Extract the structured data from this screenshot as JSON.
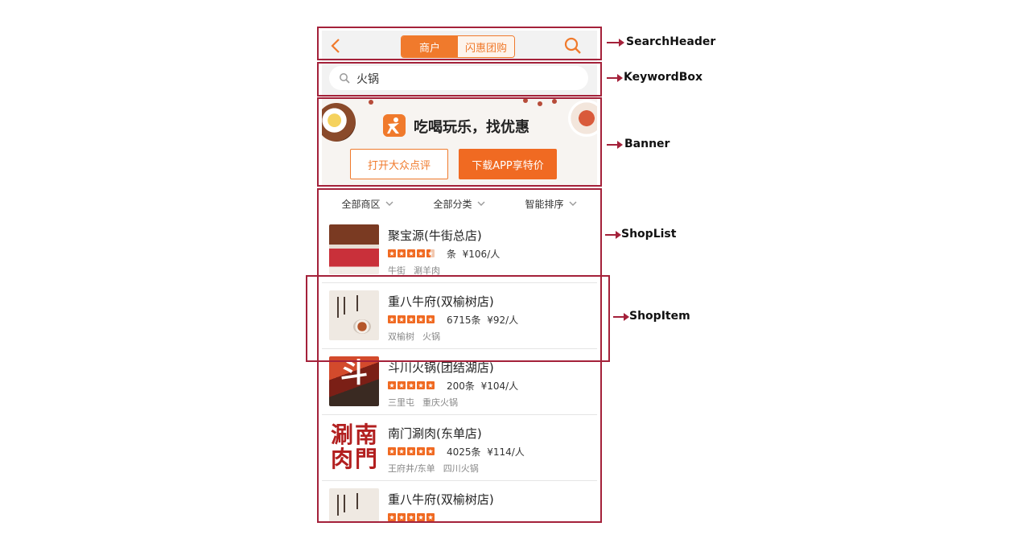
{
  "header": {
    "tab_merchants": "商户",
    "tab_flash_deals": "闪惠团购"
  },
  "keyword_box": {
    "value": "火锅"
  },
  "banner": {
    "title": "吃喝玩乐，找优惠",
    "open_button": "打开大众点评",
    "download_button": "下载APP享特价"
  },
  "filters": [
    "全部商区",
    "全部分类",
    "智能排序"
  ],
  "shops": [
    {
      "name": "聚宝源(牛街总店)",
      "rating": 4.5,
      "reviews": "",
      "review_unit": "条",
      "price": "¥106/人",
      "tags": [
        "牛街",
        "涮羊肉"
      ]
    },
    {
      "name": "重八牛府(双榆树店)",
      "rating": 5,
      "reviews": "6715",
      "review_unit": "条",
      "price": "¥92/人",
      "tags": [
        "双榆树",
        "火锅"
      ]
    },
    {
      "name": "斗川火锅(团结湖店)",
      "rating": 5,
      "reviews": "200",
      "review_unit": "条",
      "price": "¥104/人",
      "tags": [
        "三里屯",
        "重庆火锅"
      ]
    },
    {
      "name": "南门涮肉(东单店)",
      "rating": 5,
      "reviews": "4025",
      "review_unit": "条",
      "price": "¥114/人",
      "tags": [
        "王府井/东单",
        "四川火锅"
      ]
    },
    {
      "name": "重八牛府(双榆树店)",
      "rating": 5,
      "reviews": "",
      "review_unit": "",
      "price": "",
      "tags": []
    }
  ],
  "annotations": {
    "search_header": "SearchHeader",
    "keyword_box": "KeywordBox",
    "banner": "Banner",
    "shop_list": "ShopList",
    "shop_item": "ShopItem"
  },
  "colors": {
    "accent": "#f07a2c",
    "annotation": "#a4213a"
  },
  "icons": {
    "back": "chevron-left-icon",
    "search": "search-icon",
    "filter_arrow": "chevron-down-icon",
    "logo": "dianping-logo-icon"
  }
}
